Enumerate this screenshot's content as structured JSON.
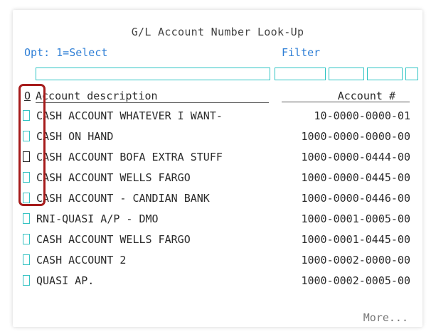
{
  "window": {
    "title": "G/L Account Number Look-Up",
    "option_hint": "Opt: 1=Select",
    "filter_label": "Filter",
    "more_label": "More..."
  },
  "columns": {
    "option": "O",
    "description": "Account description",
    "account": "Account #"
  },
  "rows": [
    {
      "description": "CASH ACCOUNT WHATEVER I WANT-",
      "account": "10-0000-0000-01"
    },
    {
      "description": "CASH ON HAND",
      "account": "1000-0000-0000-00"
    },
    {
      "description": "CASH ACCOUNT BOFA EXTRA STUFF",
      "account": "1000-0000-0444-00"
    },
    {
      "description": "CASH ACCOUNT WELLS FARGO",
      "account": "1000-0000-0445-00"
    },
    {
      "description": "CASH ACCOUNT - CANDIAN BANK",
      "account": "1000-0000-0446-00"
    },
    {
      "description": "RNI-QUASI A/P - DMO",
      "account": "1000-0001-0005-00"
    },
    {
      "description": "CASH ACCOUNT WELLS FARGO",
      "account": "1000-0001-0445-00"
    },
    {
      "description": "CASH ACCOUNT 2",
      "account": "1000-0002-0000-00"
    },
    {
      "description": "QUASI AP.",
      "account": "1000-0002-0005-00"
    }
  ],
  "colors": {
    "accent_blue": "#2f7fd6",
    "field_border": "#2ec4c4",
    "highlight": "#a61b1b"
  }
}
